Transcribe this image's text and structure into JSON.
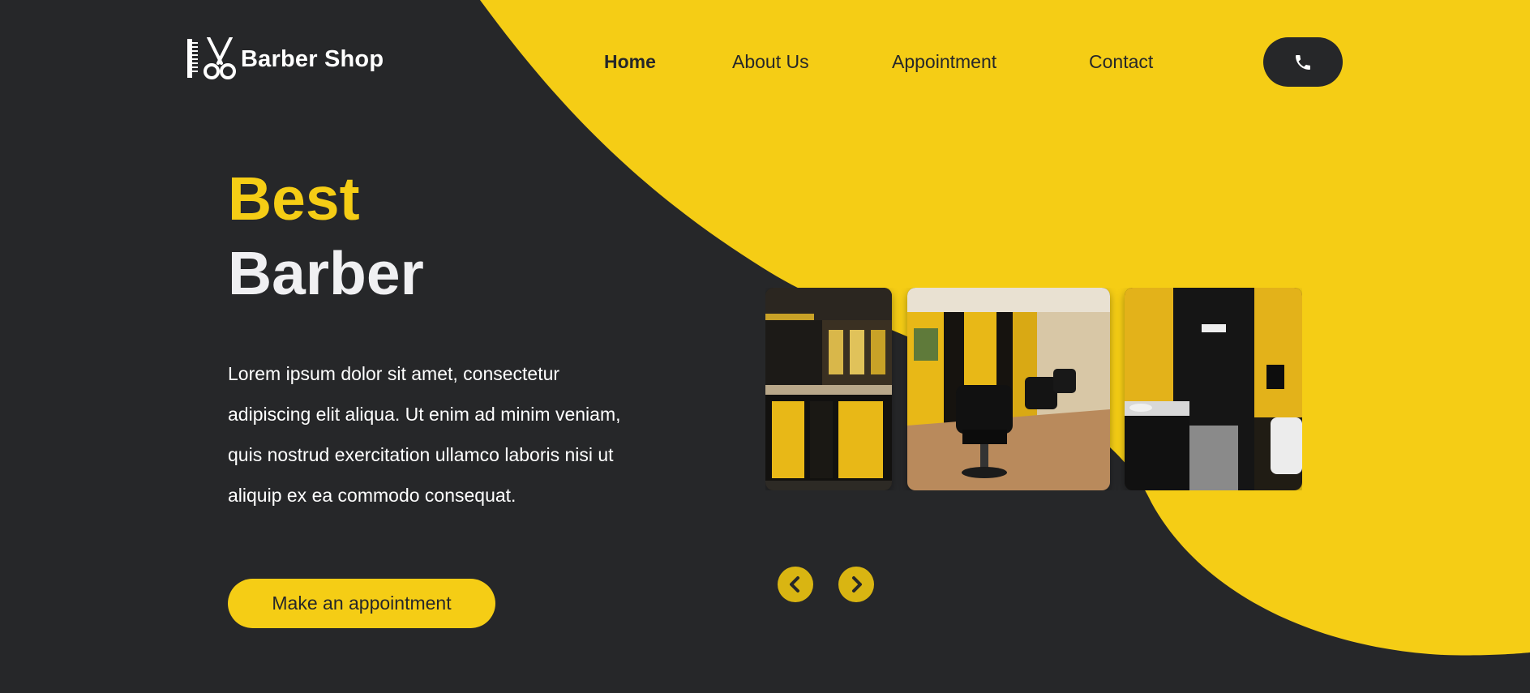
{
  "brand": {
    "name": "Barber Shop",
    "logo_icon": "comb-scissors-icon"
  },
  "colors": {
    "accent": "#f5cd15",
    "dark": "#262729",
    "text_light": "#ffffff"
  },
  "nav": {
    "items": [
      {
        "label": "Home",
        "active": true
      },
      {
        "label": "About Us",
        "active": false
      },
      {
        "label": "Appointment",
        "active": false
      },
      {
        "label": "Contact",
        "active": false
      }
    ],
    "phone_icon": "phone-icon"
  },
  "hero": {
    "title_line1": "Best",
    "title_line2": "Barber",
    "description": "Lorem ipsum dolor sit amet, consectetur adipiscing elit aliqua. Ut enim ad minim veniam, quis nostrud exercitation ullamco laboris nisi ut aliquip ex ea commodo consequat.",
    "cta_label": "Make an appointment"
  },
  "gallery": {
    "images": [
      {
        "name": "barbershop-reception-image"
      },
      {
        "name": "barber-chairs-image"
      },
      {
        "name": "restroom-image"
      }
    ],
    "prev_icon": "chevron-left-icon",
    "next_icon": "chevron-right-icon"
  }
}
